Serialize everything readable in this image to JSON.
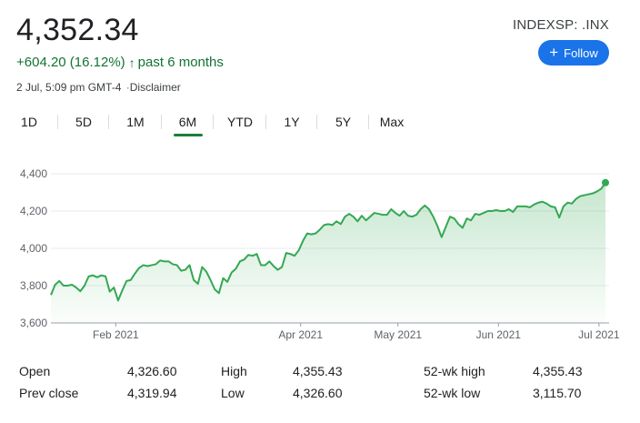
{
  "quote": {
    "price": "4,352.34",
    "change": "+604.20 (16.12%)",
    "period": "past 6 months",
    "timestamp": "2 Jul, 5:09 pm GMT-4",
    "disclaimer": "Disclaimer",
    "ticker": "INDEXSP: .INX",
    "follow_label": "Follow"
  },
  "colors": {
    "up": "#137333",
    "line": "#34a853",
    "accent": "#1a73e8"
  },
  "tabs": [
    {
      "label": "1D",
      "active": false
    },
    {
      "label": "5D",
      "active": false
    },
    {
      "label": "1M",
      "active": false
    },
    {
      "label": "6M",
      "active": true
    },
    {
      "label": "YTD",
      "active": false
    },
    {
      "label": "1Y",
      "active": false
    },
    {
      "label": "5Y",
      "active": false
    },
    {
      "label": "Max",
      "active": false
    }
  ],
  "chart_data": {
    "type": "area",
    "y_ticks": [
      "4,400",
      "4,200",
      "4,000",
      "3,800",
      "3,600"
    ],
    "ylim": [
      3600,
      4400
    ],
    "x_ticks": [
      {
        "label": "Feb 2021",
        "x": 20
      },
      {
        "label": "Apr 2021",
        "x": 77
      },
      {
        "label": "May 2021",
        "x": 107
      },
      {
        "label": "Jun 2021",
        "x": 138
      },
      {
        "label": "Jul 2021",
        "x": 169
      }
    ],
    "xlim": [
      0,
      171
    ],
    "grid": true,
    "series": [
      {
        "values": [
          3750,
          3805,
          3825,
          3800,
          3800,
          3805,
          3790,
          3770,
          3800,
          3850,
          3855,
          3845,
          3855,
          3850,
          3768,
          3790,
          3720,
          3775,
          3825,
          3830,
          3865,
          3895,
          3910,
          3905,
          3910,
          3915,
          3935,
          3930,
          3930,
          3915,
          3910,
          3880,
          3885,
          3910,
          3830,
          3810,
          3900,
          3875,
          3830,
          3780,
          3760,
          3840,
          3820,
          3870,
          3890,
          3930,
          3940,
          3965,
          3960,
          3970,
          3910,
          3910,
          3930,
          3905,
          3885,
          3900,
          3975,
          3970,
          3960,
          3990,
          4040,
          4080,
          4075,
          4080,
          4100,
          4125,
          4130,
          4125,
          4145,
          4130,
          4170,
          4185,
          4170,
          4145,
          4175,
          4150,
          4170,
          4190,
          4185,
          4180,
          4180,
          4210,
          4190,
          4175,
          4200,
          4175,
          4170,
          4180,
          4210,
          4230,
          4210,
          4170,
          4120,
          4060,
          4115,
          4170,
          4160,
          4130,
          4110,
          4160,
          4150,
          4185,
          4180,
          4190,
          4200,
          4200,
          4205,
          4200,
          4200,
          4210,
          4195,
          4225,
          4225,
          4225,
          4220,
          4235,
          4245,
          4250,
          4240,
          4225,
          4220,
          4165,
          4225,
          4245,
          4240,
          4265,
          4280,
          4285,
          4290,
          4295,
          4305,
          4320,
          4352.34
        ]
      }
    ]
  },
  "stats": [
    {
      "label": "Open",
      "value": "4,326.60"
    },
    {
      "label": "High",
      "value": "4,355.43"
    },
    {
      "label": "52-wk high",
      "value": "4,355.43"
    },
    {
      "label": "Prev close",
      "value": "4,319.94"
    },
    {
      "label": "Low",
      "value": "4,326.60"
    },
    {
      "label": "52-wk low",
      "value": "3,115.70"
    }
  ]
}
